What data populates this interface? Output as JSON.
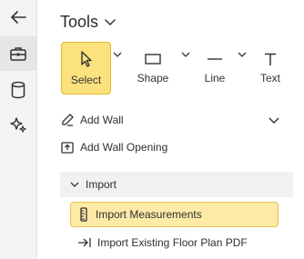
{
  "header": {
    "title": "Tools"
  },
  "rail": {
    "items": [
      {
        "icon": "back-arrow-icon"
      },
      {
        "icon": "toolbox-icon",
        "active": true
      },
      {
        "icon": "database-icon"
      },
      {
        "icon": "sparkles-icon"
      }
    ]
  },
  "tools": [
    {
      "label": "Select",
      "icon": "cursor-icon",
      "selected": true
    },
    {
      "label": "Shape",
      "icon": "rectangle-icon"
    },
    {
      "label": "Line",
      "icon": "line-icon"
    },
    {
      "label": "Text",
      "icon": "text-icon"
    }
  ],
  "actions": {
    "add_wall": "Add Wall",
    "add_wall_opening": "Add Wall Opening"
  },
  "import_section": {
    "title": "Import",
    "items": [
      {
        "label": "Import Measurements",
        "icon": "ruler-icon",
        "highlighted": true
      },
      {
        "label": "Import Existing Floor Plan PDF",
        "icon": "import-arrow-icon"
      }
    ]
  },
  "colors": {
    "selected_fill": "#fbe27e",
    "selected_border": "#e5b92e",
    "highlight_fill": "#fdeaa7",
    "rail_bg": "#f3f3f3"
  }
}
